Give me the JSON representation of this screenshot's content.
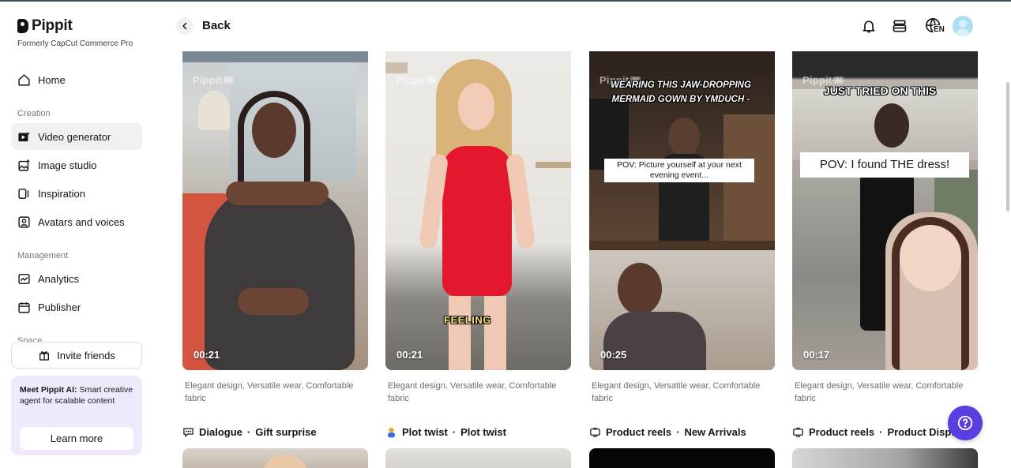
{
  "brand": {
    "name": "Pippit",
    "subtitle": "Formerly CapCut Commerce Pro"
  },
  "sidebar": {
    "home": "Home",
    "creation_label": "Creation",
    "creation_items": [
      "Video generator",
      "Image studio",
      "Inspiration",
      "Avatars and voices"
    ],
    "management_label": "Management",
    "management_items": [
      "Analytics",
      "Publisher"
    ],
    "space_label": "Space",
    "invite": "Invite friends",
    "promo": {
      "title": "Meet Pippit AI:",
      "body": " Smart creative agent for scalable content",
      "button": "Learn more"
    }
  },
  "header": {
    "back": "Back",
    "language": "EN"
  },
  "watermark": {
    "brand": "Pippit",
    "tag": "AI"
  },
  "cards": [
    {
      "duration": "00:21",
      "description": "Elegant design, Versatile wear, Comfortable fabric"
    },
    {
      "duration": "00:21",
      "description": "Elegant design, Versatile wear, Comfortable fabric",
      "caption": "FEELING"
    },
    {
      "duration": "00:25",
      "description": "Elegant design, Versatile wear, Comfortable fabric",
      "caption_top": "WEARING THIS JAW-DROPPING MERMAID GOWN BY YMDUCH -",
      "caption_box": "POV: Picture yourself at your next evening event..."
    },
    {
      "duration": "00:17",
      "description": "Elegant design, Versatile wear, Comfortable fabric",
      "caption_top": "JUST TRIED ON THIS",
      "caption_box": "POV: I found THE dress!"
    }
  ],
  "next_row": [
    {
      "category": "Dialogue",
      "subcategory": "Gift surprise",
      "icon": "speech-bubble-icon"
    },
    {
      "category": "Plot twist",
      "subcategory": "Plot twist",
      "icon": "person-icon"
    },
    {
      "category": "Product reels",
      "subcategory": "New Arrivals",
      "icon": "tv-icon"
    },
    {
      "category": "Product reels",
      "subcategory": "Product Display",
      "icon": "tv-icon"
    }
  ],
  "colors": {
    "accent": "#5b3de0",
    "promo_bg": "#efe9fb",
    "active_nav": "#f0f0f3"
  }
}
